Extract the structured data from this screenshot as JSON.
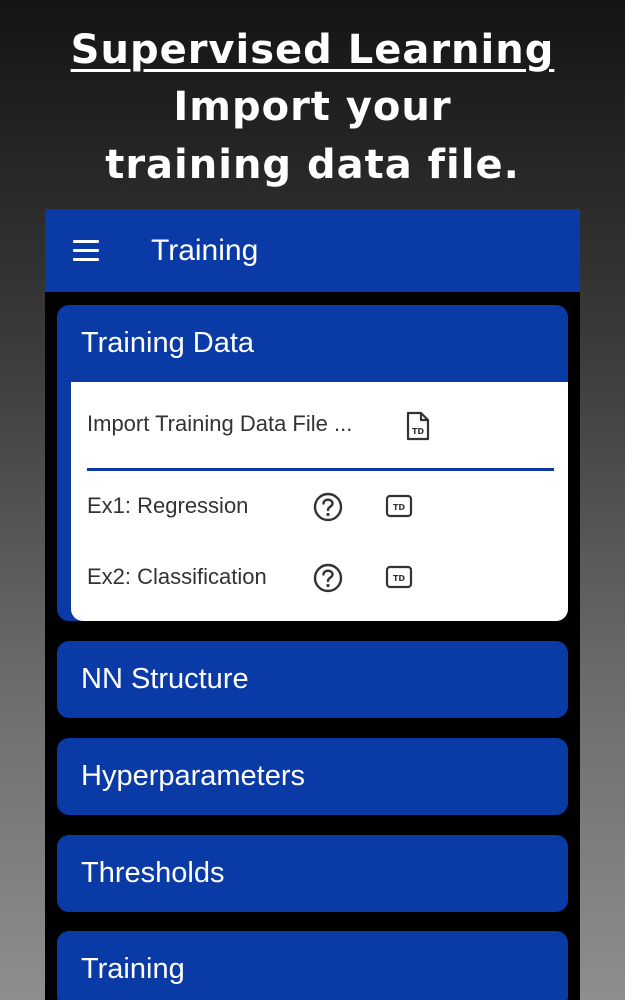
{
  "promo": {
    "title": "Supervised Learning",
    "line1": "Import your",
    "line2": "training data file."
  },
  "appbar": {
    "title": "Training",
    "menu_icon": "hamburger-menu-icon"
  },
  "sections": {
    "training_data": {
      "title": "Training Data",
      "import_label": "Import Training Data File ...",
      "import_icon": "td-file-icon",
      "ex1_label": "Ex1: Regression",
      "ex2_label": "Ex2: Classification",
      "help_icon": "help-circle-icon",
      "load_icon": "td-badge-icon",
      "icon_glyph": "TD"
    },
    "nn_structure": {
      "title": "NN Structure"
    },
    "hyperparameters": {
      "title": "Hyperparameters"
    },
    "thresholds": {
      "title": "Thresholds"
    },
    "training": {
      "title": "Training"
    }
  },
  "colors": {
    "primary": "#0a3aa6",
    "panel": "#ffffff",
    "background": "#000000",
    "text_dark": "#333333"
  }
}
